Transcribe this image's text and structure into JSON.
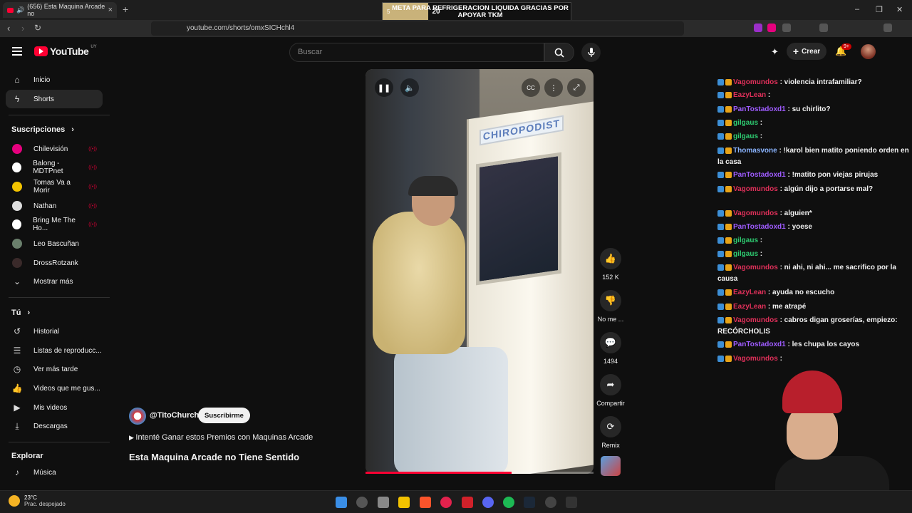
{
  "browser": {
    "tab_title": "(656) Esta Maquina Arcade no",
    "url": "youtube.com/shorts/omxSICHchl4"
  },
  "stream_overlay": {
    "progress_number": "5",
    "message": "META PARA REFRIGERACION LIQUIDA GRACIAS POR APOYAR TKM",
    "goal_number": "20"
  },
  "header": {
    "logo_text": "YouTube",
    "country_code": "UY",
    "search_placeholder": "Buscar",
    "create_label": "Crear",
    "notification_count": "9+"
  },
  "sidebar": {
    "main": [
      {
        "label": "Inicio",
        "icon": "home-icon"
      },
      {
        "label": "Shorts",
        "icon": "shorts-icon",
        "active": true
      }
    ],
    "subscriptions_heading": "Suscripciones",
    "subscriptions": [
      {
        "label": "Chilevisión",
        "color": "#e6007e",
        "live": true
      },
      {
        "label": "Balong - MDTPnet",
        "color": "#ffffff",
        "live": true
      },
      {
        "label": "Tomas Va a Morir",
        "color": "#f2c300",
        "live": true
      },
      {
        "label": "Nathan",
        "color": "#dddddd",
        "live": true
      },
      {
        "label": "Bring Me The Ho...",
        "color": "#ffffff",
        "live": true
      },
      {
        "label": "Leo Bascuñan",
        "color": "#6a7f6c",
        "live": false
      },
      {
        "label": "DrossRotzank",
        "color": "#3a2a2a",
        "live": false
      },
      {
        "label": "Mostrar más",
        "color": "",
        "live": false
      }
    ],
    "you_heading": "Tú",
    "you_items": [
      {
        "label": "Historial",
        "icon": "history-icon"
      },
      {
        "label": "Listas de reproducc...",
        "icon": "playlists-icon"
      },
      {
        "label": "Ver más tarde",
        "icon": "watch-later-icon"
      },
      {
        "label": "Videos que me gus...",
        "icon": "liked-videos-icon"
      },
      {
        "label": "Mis videos",
        "icon": "my-videos-icon"
      },
      {
        "label": "Descargas",
        "icon": "downloads-icon"
      }
    ],
    "explore_heading": "Explorar",
    "explore_items": [
      {
        "label": "Música",
        "icon": "music-icon"
      }
    ]
  },
  "video": {
    "sign_text": "CHIROPODIST",
    "progress": 0.64
  },
  "actions": {
    "likes": "152 K",
    "dislike_label": "No me ...",
    "comments": "1494",
    "share_label": "Compartir",
    "remix_label": "Remix"
  },
  "channel": {
    "name": "@TitoChurch",
    "subscribe_label": "Suscribirme",
    "playlist_text": "Intenté Ganar estos Premios con Maquinas Arcade",
    "title": "Esta Maquina Arcade no Tiene Sentido"
  },
  "chat": {
    "messages": [
      {
        "user": "Vagomundos",
        "color": "#e0305a",
        "text": ": violencia intrafamiliar?"
      },
      {
        "user": "EazyLean",
        "color": "#e0305a",
        "text": ":"
      },
      {
        "user": "PanTostadoxd1",
        "color": "#9f5cff",
        "text": ": su chirlito?"
      },
      {
        "user": "gilgaus",
        "color": "#2ecc71",
        "text": ":"
      },
      {
        "user": "gilgaus",
        "color": "#2ecc71",
        "text": ":"
      },
      {
        "user": "Thomasvone",
        "color": "#8ab4ff",
        "text": ": !karol bien matito poniendo orden en la casa"
      },
      {
        "user": "PanTostadoxd1",
        "color": "#9f5cff",
        "text": ": !matito pon viejas pirujas"
      },
      {
        "user": "Vagomundos",
        "color": "#e0305a",
        "text": ": algún dijo a portarse mal?"
      },
      {
        "user": "Vagomundos",
        "color": "#e0305a",
        "text": ": alguien*"
      },
      {
        "user": "PanTostadoxd1",
        "color": "#9f5cff",
        "text": ": yoese"
      },
      {
        "user": "gilgaus",
        "color": "#2ecc71",
        "text": ":"
      },
      {
        "user": "gilgaus",
        "color": "#2ecc71",
        "text": ":"
      },
      {
        "user": "Vagomundos",
        "color": "#e0305a",
        "text": ": ni ahi, ni ahi... me sacrifico por la causa"
      },
      {
        "user": "EazyLean",
        "color": "#e0305a",
        "text": ": ayuda no escucho"
      },
      {
        "user": "EazyLean",
        "color": "#e0305a",
        "text": ": me atrapé"
      },
      {
        "user": "Vagomundos",
        "color": "#e0305a",
        "text": ": cabros digan groserías, empiezo: RECÓRCHOLIS"
      },
      {
        "user": "PanTostadoxd1",
        "color": "#9f5cff",
        "text": ": les chupa los cayos"
      },
      {
        "user": "Vagomundos",
        "color": "#e0305a",
        "text": ":"
      }
    ]
  },
  "taskbar": {
    "temperature": "23°C",
    "weather": "Prac. despejado"
  }
}
